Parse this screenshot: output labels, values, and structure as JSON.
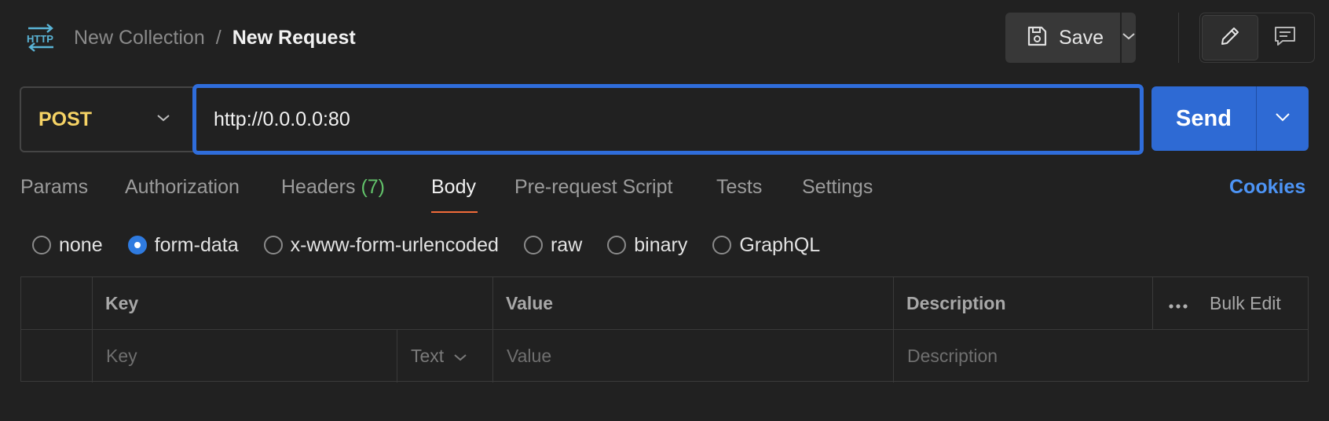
{
  "header": {
    "icon": "http-icon",
    "breadcrumb": {
      "collection": "New Collection",
      "separator": "/",
      "request": "New Request"
    },
    "save_label": "Save",
    "mode_buttons": [
      "pencil-icon",
      "comment-icon"
    ]
  },
  "request": {
    "method": "POST",
    "url": "http://0.0.0.0:80",
    "send_label": "Send"
  },
  "tabs": {
    "params": "Params",
    "authorization": "Authorization",
    "headers": "Headers",
    "headers_count": "(7)",
    "body": "Body",
    "pre_request": "Pre-request Script",
    "tests": "Tests",
    "settings": "Settings",
    "active": "Body",
    "cookies": "Cookies"
  },
  "body_type": {
    "options": [
      "none",
      "form-data",
      "x-www-form-urlencoded",
      "raw",
      "binary",
      "GraphQL"
    ],
    "selected": "form-data"
  },
  "table": {
    "headers": {
      "key": "Key",
      "value": "Value",
      "description": "Description",
      "bulk_edit": "Bulk Edit"
    },
    "row": {
      "key_placeholder": "Key",
      "type": "Text",
      "value_placeholder": "Value",
      "description_placeholder": "Description"
    }
  },
  "colors": {
    "background": "#212121",
    "method": "#f6d365",
    "accent": "#2e6ad4",
    "tab_underline": "#f26b3a",
    "count": "#62c26a",
    "link": "#4d94f5"
  }
}
